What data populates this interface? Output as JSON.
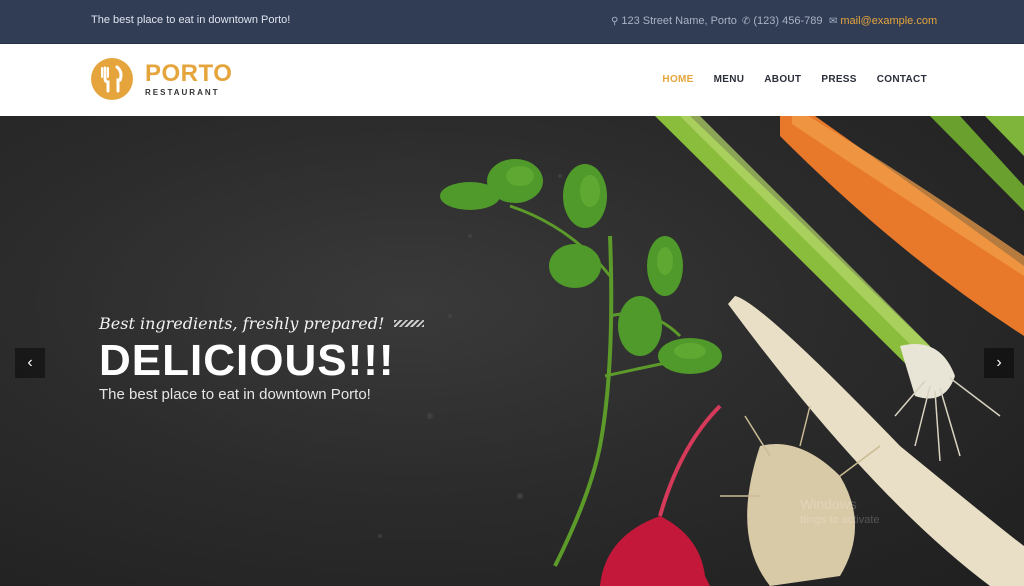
{
  "topbar": {
    "tagline": "The best place to eat in downtown Porto!",
    "address": "123 Street Name, Porto",
    "phone": "(123) 456-789",
    "email": "mail@example.com"
  },
  "logo": {
    "name": "PORTO",
    "subtitle": "RESTAURANT"
  },
  "nav": {
    "items": [
      {
        "label": "HOME",
        "active": true
      },
      {
        "label": "MENU"
      },
      {
        "label": "ABOUT"
      },
      {
        "label": "PRESS"
      },
      {
        "label": "CONTACT"
      }
    ]
  },
  "hero": {
    "kicker": "Best ingredients, freshly prepared!",
    "headline": "DELICIOUS!!!",
    "subline": "The best place to eat in downtown Porto!"
  },
  "slider": {
    "prev_icon": "chevron-left-icon",
    "next_icon": "chevron-right-icon"
  },
  "watermark": {
    "line1": "Windows",
    "line2": "ttings to activate"
  },
  "colors": {
    "accent": "#e5a53c",
    "topbar": "#313c55",
    "nav_text": "#2b2f3a"
  }
}
